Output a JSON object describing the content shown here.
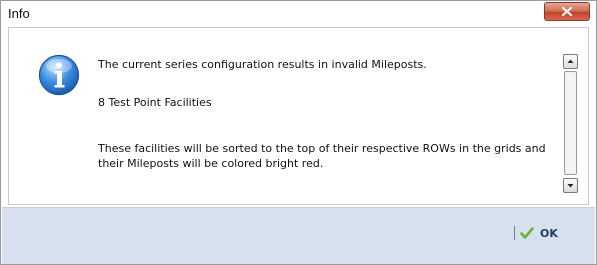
{
  "window": {
    "title": "Info",
    "close_icon": "close-icon"
  },
  "message": {
    "icon": "info-icon",
    "line1": "The current series configuration results in invalid Mileposts.",
    "line2": "8 Test Point Facilities",
    "line3a": "These facilities will be sorted to the top of their respective ROWs in the grids and",
    "line3b": "their Mileposts will be colored bright red."
  },
  "footer": {
    "ok_label": "OK",
    "ok_icon": "checkmark-icon"
  },
  "colors": {
    "close_button": "#c0452c",
    "footer_background": "#d6e0ee",
    "ok_check": "#6db33f"
  }
}
